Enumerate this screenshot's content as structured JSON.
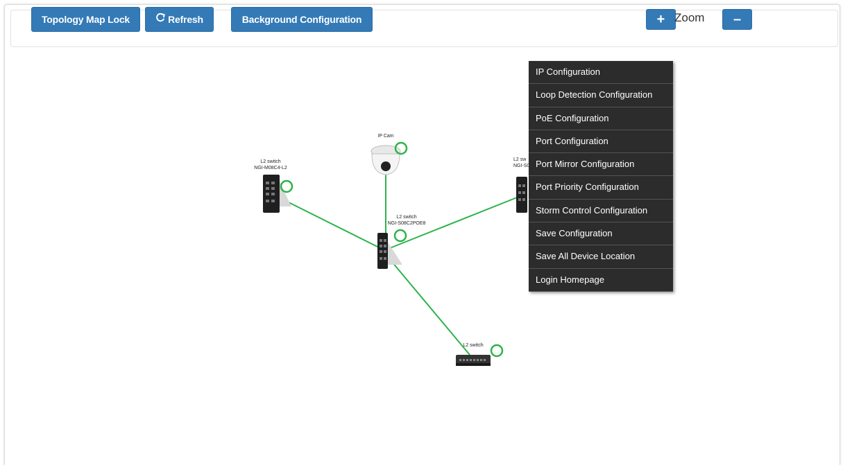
{
  "toolbar": {
    "lock_label": "Topology Map Lock",
    "refresh_label": "Refresh",
    "background_label": "Background Configuration",
    "zoom_label": "Zoom",
    "zoom_in_label": "+",
    "zoom_out_label": "–"
  },
  "colors": {
    "button_blue": "#337ab7",
    "link_green": "#2db34a",
    "menu_bg": "#2c2c2c"
  },
  "devices": {
    "left_switch": {
      "type_label": "L2 switch",
      "model_label": "NGI-M08C4-L2"
    },
    "ip_cam": {
      "type_label": "IP Cam"
    },
    "center_switch": {
      "type_label": "L2 switch",
      "model_label": "NGI-S08C2POE8"
    },
    "right_switch": {
      "type_label": "L2 sw",
      "model_label": "NGI-S0"
    },
    "bottom_switch": {
      "type_label": "L2 switch"
    }
  },
  "context_menu": {
    "items": [
      "IP Configuration",
      "Loop Detection Configuration",
      "PoE Configuration",
      "Port Configuration",
      "Port Mirror Configuration",
      "Port Priority Configuration",
      "Storm Control Configuration",
      "Save Configuration",
      "Save All Device Location",
      "Login Homepage"
    ]
  }
}
